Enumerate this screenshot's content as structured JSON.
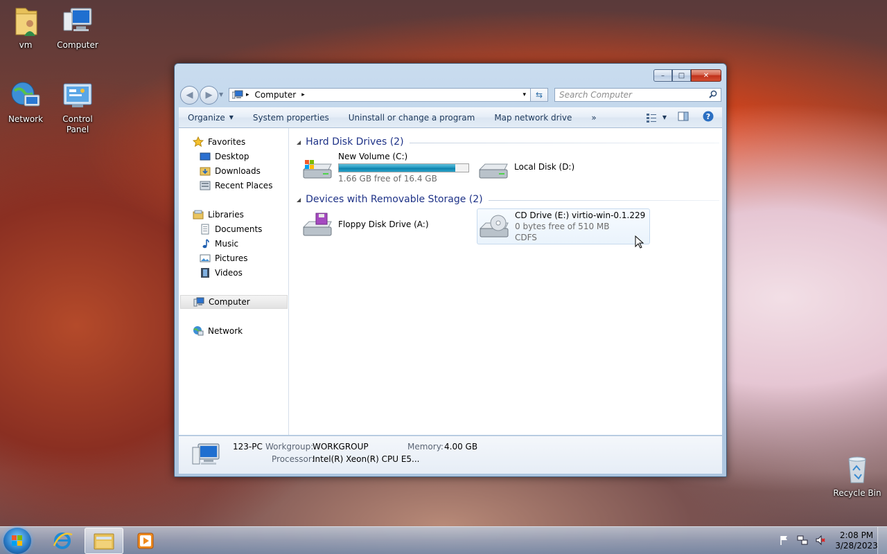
{
  "desktop": {
    "icons": [
      {
        "label": "vm"
      },
      {
        "label": "Computer"
      },
      {
        "label": "Network"
      },
      {
        "label": "Control Panel"
      },
      {
        "label": "Recycle Bin"
      }
    ]
  },
  "window": {
    "caption_buttons": {
      "minimize": "–",
      "maximize": "□",
      "close": "✕"
    },
    "address": {
      "separator": "▸",
      "location": "Computer",
      "dropdown": "▾"
    },
    "search": {
      "placeholder": "Search Computer"
    },
    "commands": {
      "organize": "Organize",
      "system_properties": "System properties",
      "uninstall": "Uninstall or change a program",
      "map_drive": "Map network drive",
      "more": "»"
    },
    "nav": {
      "favorites": "Favorites",
      "desktop": "Desktop",
      "downloads": "Downloads",
      "recent_places": "Recent Places",
      "libraries": "Libraries",
      "documents": "Documents",
      "music": "Music",
      "pictures": "Pictures",
      "videos": "Videos",
      "computer": "Computer",
      "network": "Network"
    },
    "groups": {
      "hard_disks": "Hard Disk Drives (2)",
      "removable": "Devices with Removable Storage (2)"
    },
    "drives": {
      "c": {
        "name": "New Volume (C:)",
        "free": "1.66 GB free of 16.4 GB",
        "used_fraction": 0.9
      },
      "d": {
        "name": "Local Disk (D:)"
      },
      "a": {
        "name": "Floppy Disk Drive (A:)"
      },
      "e": {
        "name": "CD Drive (E:) virtio-win-0.1.229",
        "free": "0 bytes free of 510 MB",
        "fs": "CDFS"
      }
    },
    "details": {
      "computer_name": "123-PC",
      "workgroup_label": "Workgroup:",
      "workgroup": "WORKGROUP",
      "memory_label": "Memory:",
      "memory": "4.00 GB",
      "processor_label": "Processor:",
      "processor": "Intel(R) Xeon(R) CPU E5..."
    }
  },
  "taskbar": {
    "time": "2:08 PM",
    "date": "3/28/2023"
  },
  "colors": {
    "group_header": "#1e3287",
    "progress_fill": "#1f96be",
    "selection": "#e3e3e3"
  }
}
